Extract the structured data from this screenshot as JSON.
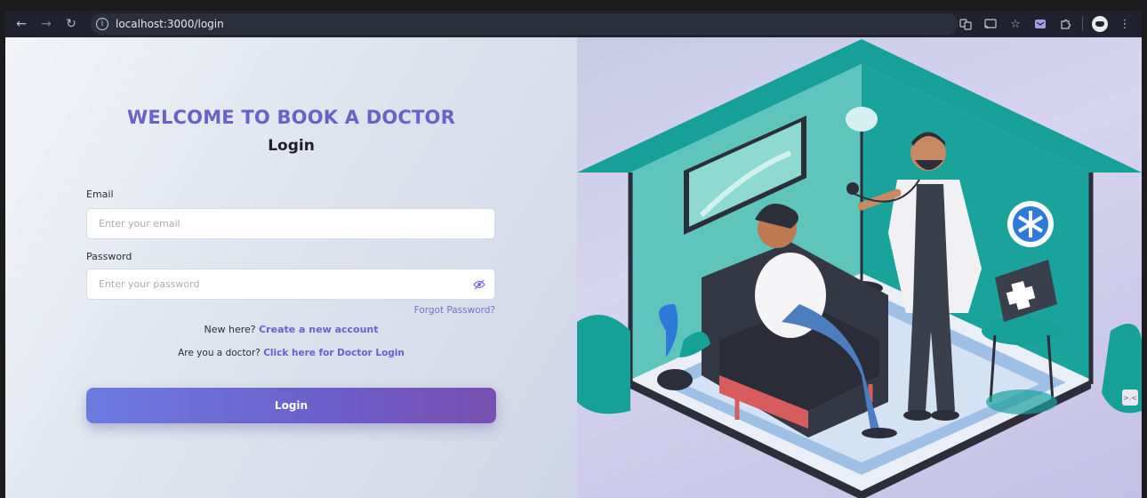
{
  "browser": {
    "url": "localhost:3000/login",
    "icons": [
      "back-icon",
      "forward-icon",
      "reload-icon",
      "site-info-icon",
      "translate-icon",
      "cast-icon",
      "bookmark-star-icon",
      "extension-mail-icon",
      "extensions-puzzle-icon",
      "profile-avatar-icon",
      "menu-dots-icon"
    ]
  },
  "page": {
    "welcome": "WELCOME TO BOOK A DOCTOR",
    "title": "Login",
    "email_label": "Email",
    "email_placeholder": "Enter your email",
    "password_label": "Password",
    "password_placeholder": "Enter your password",
    "forgot": "Forgot Password?",
    "new_here_prefix": "New here?",
    "create_account": "Create a new account",
    "doctor_prefix": "Are you a doctor?",
    "doctor_link": "Click here for Doctor Login",
    "login_button": "Login"
  },
  "colors": {
    "accent": "#6a61c9",
    "button_start": "#6b7ce0",
    "button_end": "#7a4fb1",
    "teal_room": "#1aa39a"
  },
  "illustration": {
    "subject": "doctor-examining-patient-illustration"
  }
}
